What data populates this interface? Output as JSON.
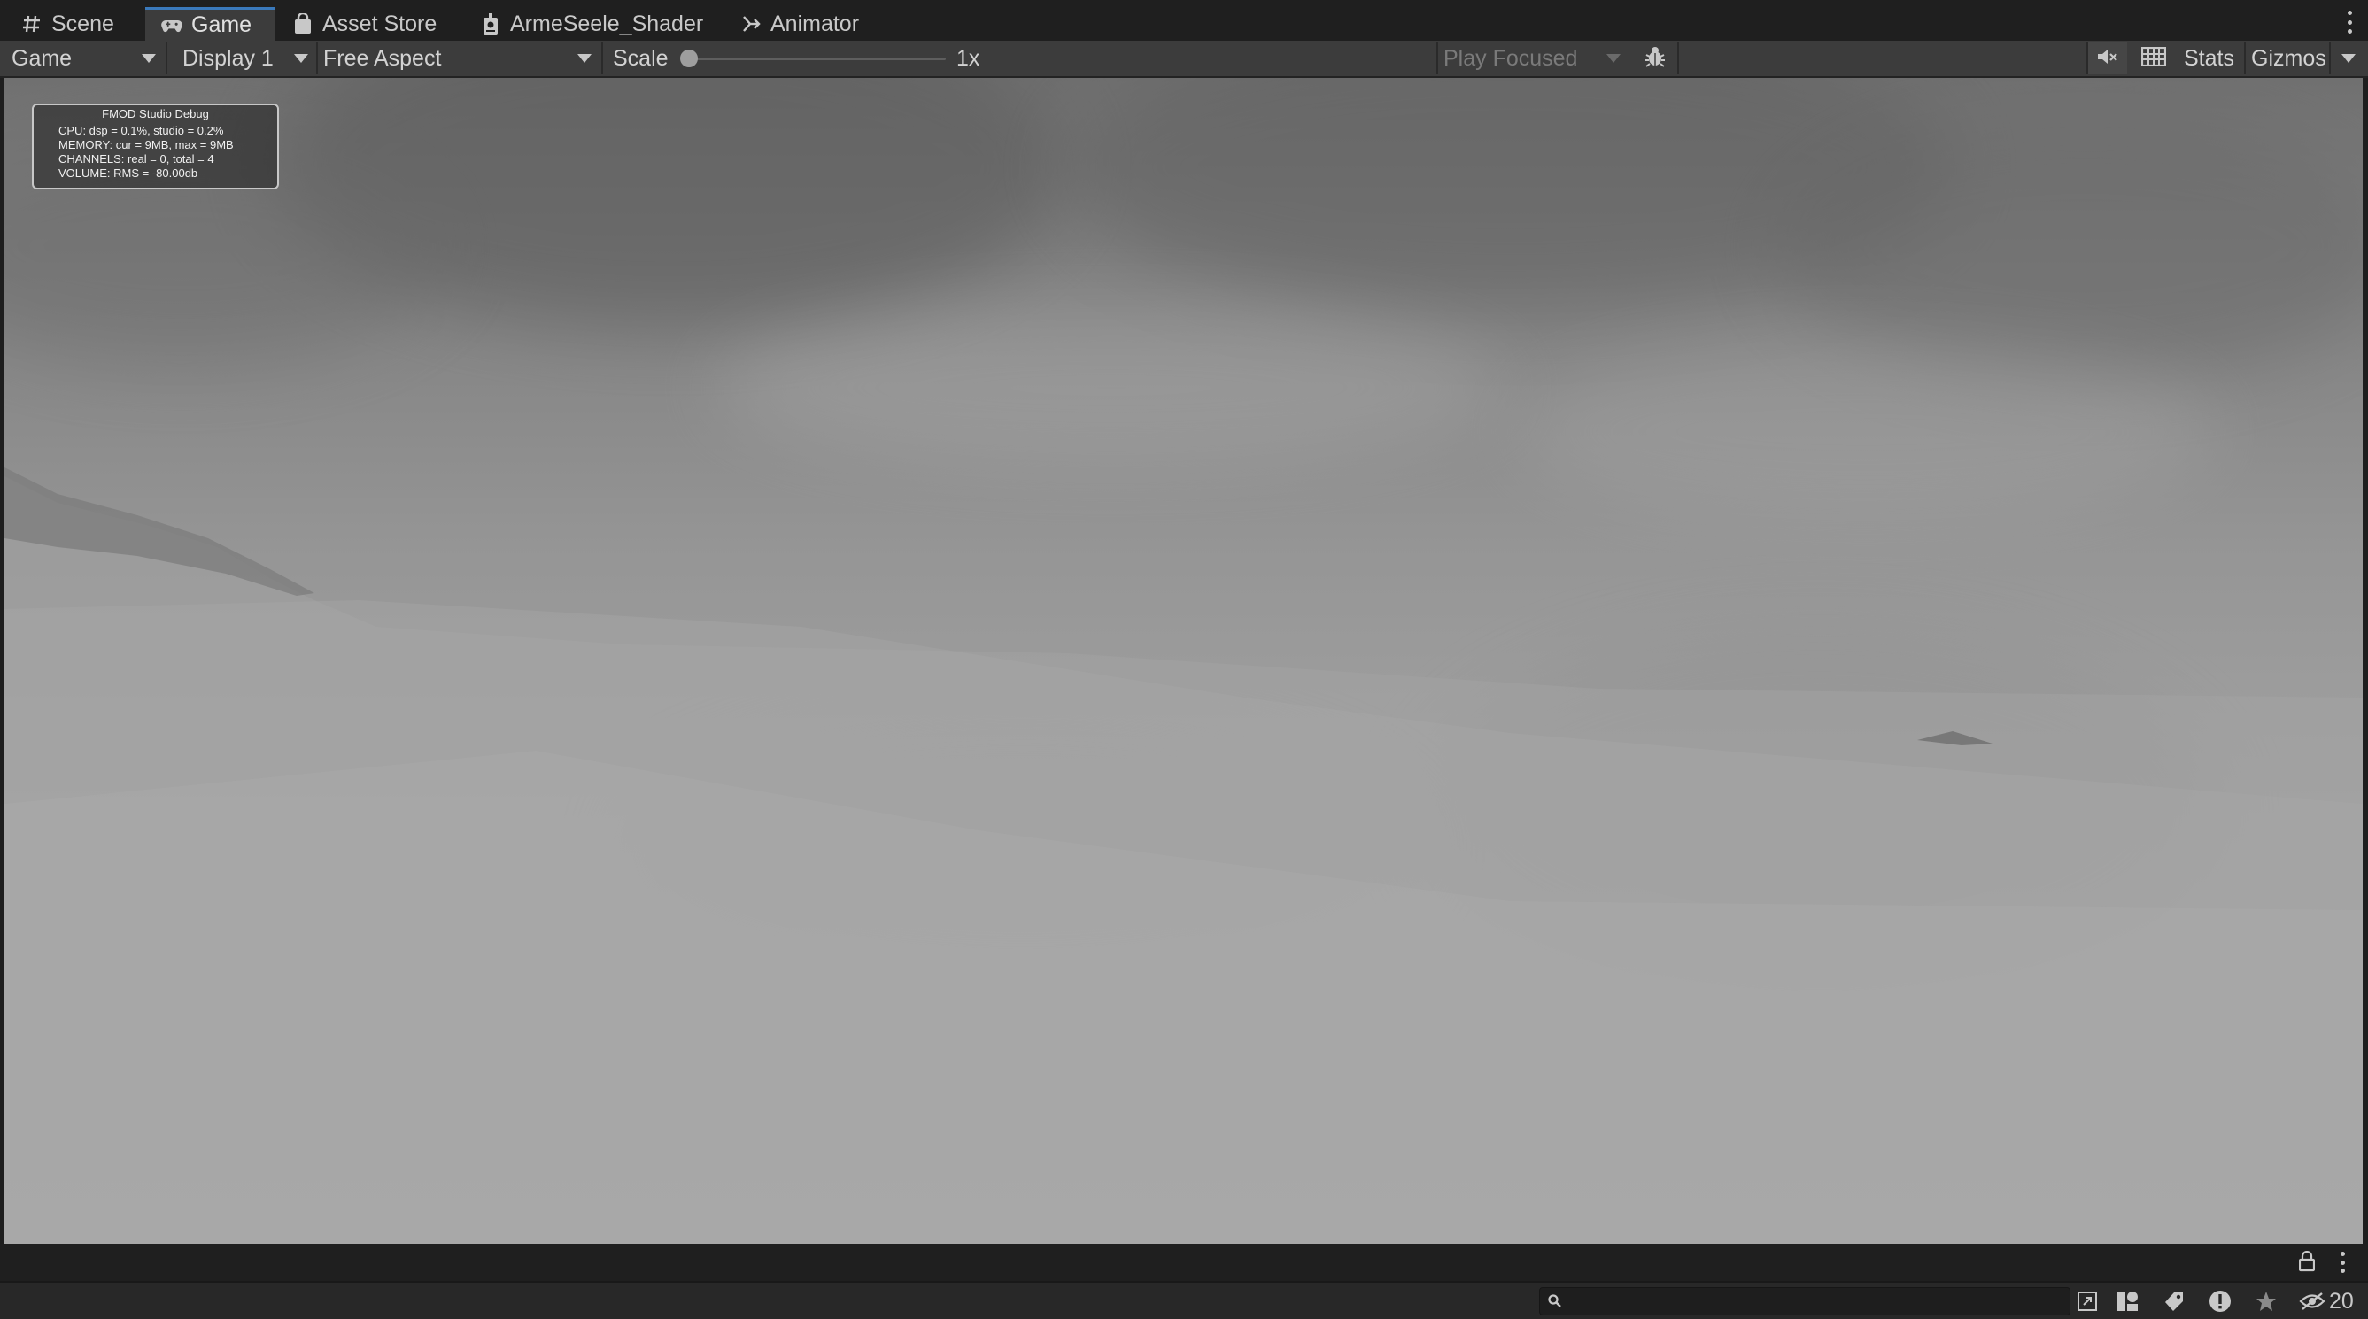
{
  "tabs": [
    {
      "label": "Scene",
      "icon": "grid-hash-icon"
    },
    {
      "label": "Game",
      "icon": "gamepad-icon",
      "active": true
    },
    {
      "label": "Asset Store",
      "icon": "shopping-bag-icon"
    },
    {
      "label": "ArmeSeele_Shader",
      "icon": "shader-graph-icon"
    },
    {
      "label": "Animator",
      "icon": "animator-icon"
    }
  ],
  "toolbar": {
    "view_dropdown": "Game",
    "display_dropdown": "Display 1",
    "aspect_dropdown": "Free Aspect",
    "scale_label": "Scale",
    "scale_value": "1x",
    "scale_fraction": 0.0,
    "play_mode_dropdown": "Play Focused",
    "stats_label": "Stats",
    "gizmos_label": "Gizmos"
  },
  "fmod_debug": {
    "title": "FMOD Studio Debug",
    "cpu": "CPU: dsp = 0.1%, studio = 0.2%",
    "memory": "MEMORY: cur = 9MB, max = 9MB",
    "channels": "CHANNELS: real = 0, total = 4",
    "volume": "VOLUME: RMS = -80.00db"
  },
  "statusbar": {
    "search_value": "",
    "hidden_count": "20"
  },
  "colors": {
    "tab_active_accent": "#3a79bb",
    "toolbar_bg": "#3c3c3c",
    "window_bg": "#1f1f1f"
  }
}
